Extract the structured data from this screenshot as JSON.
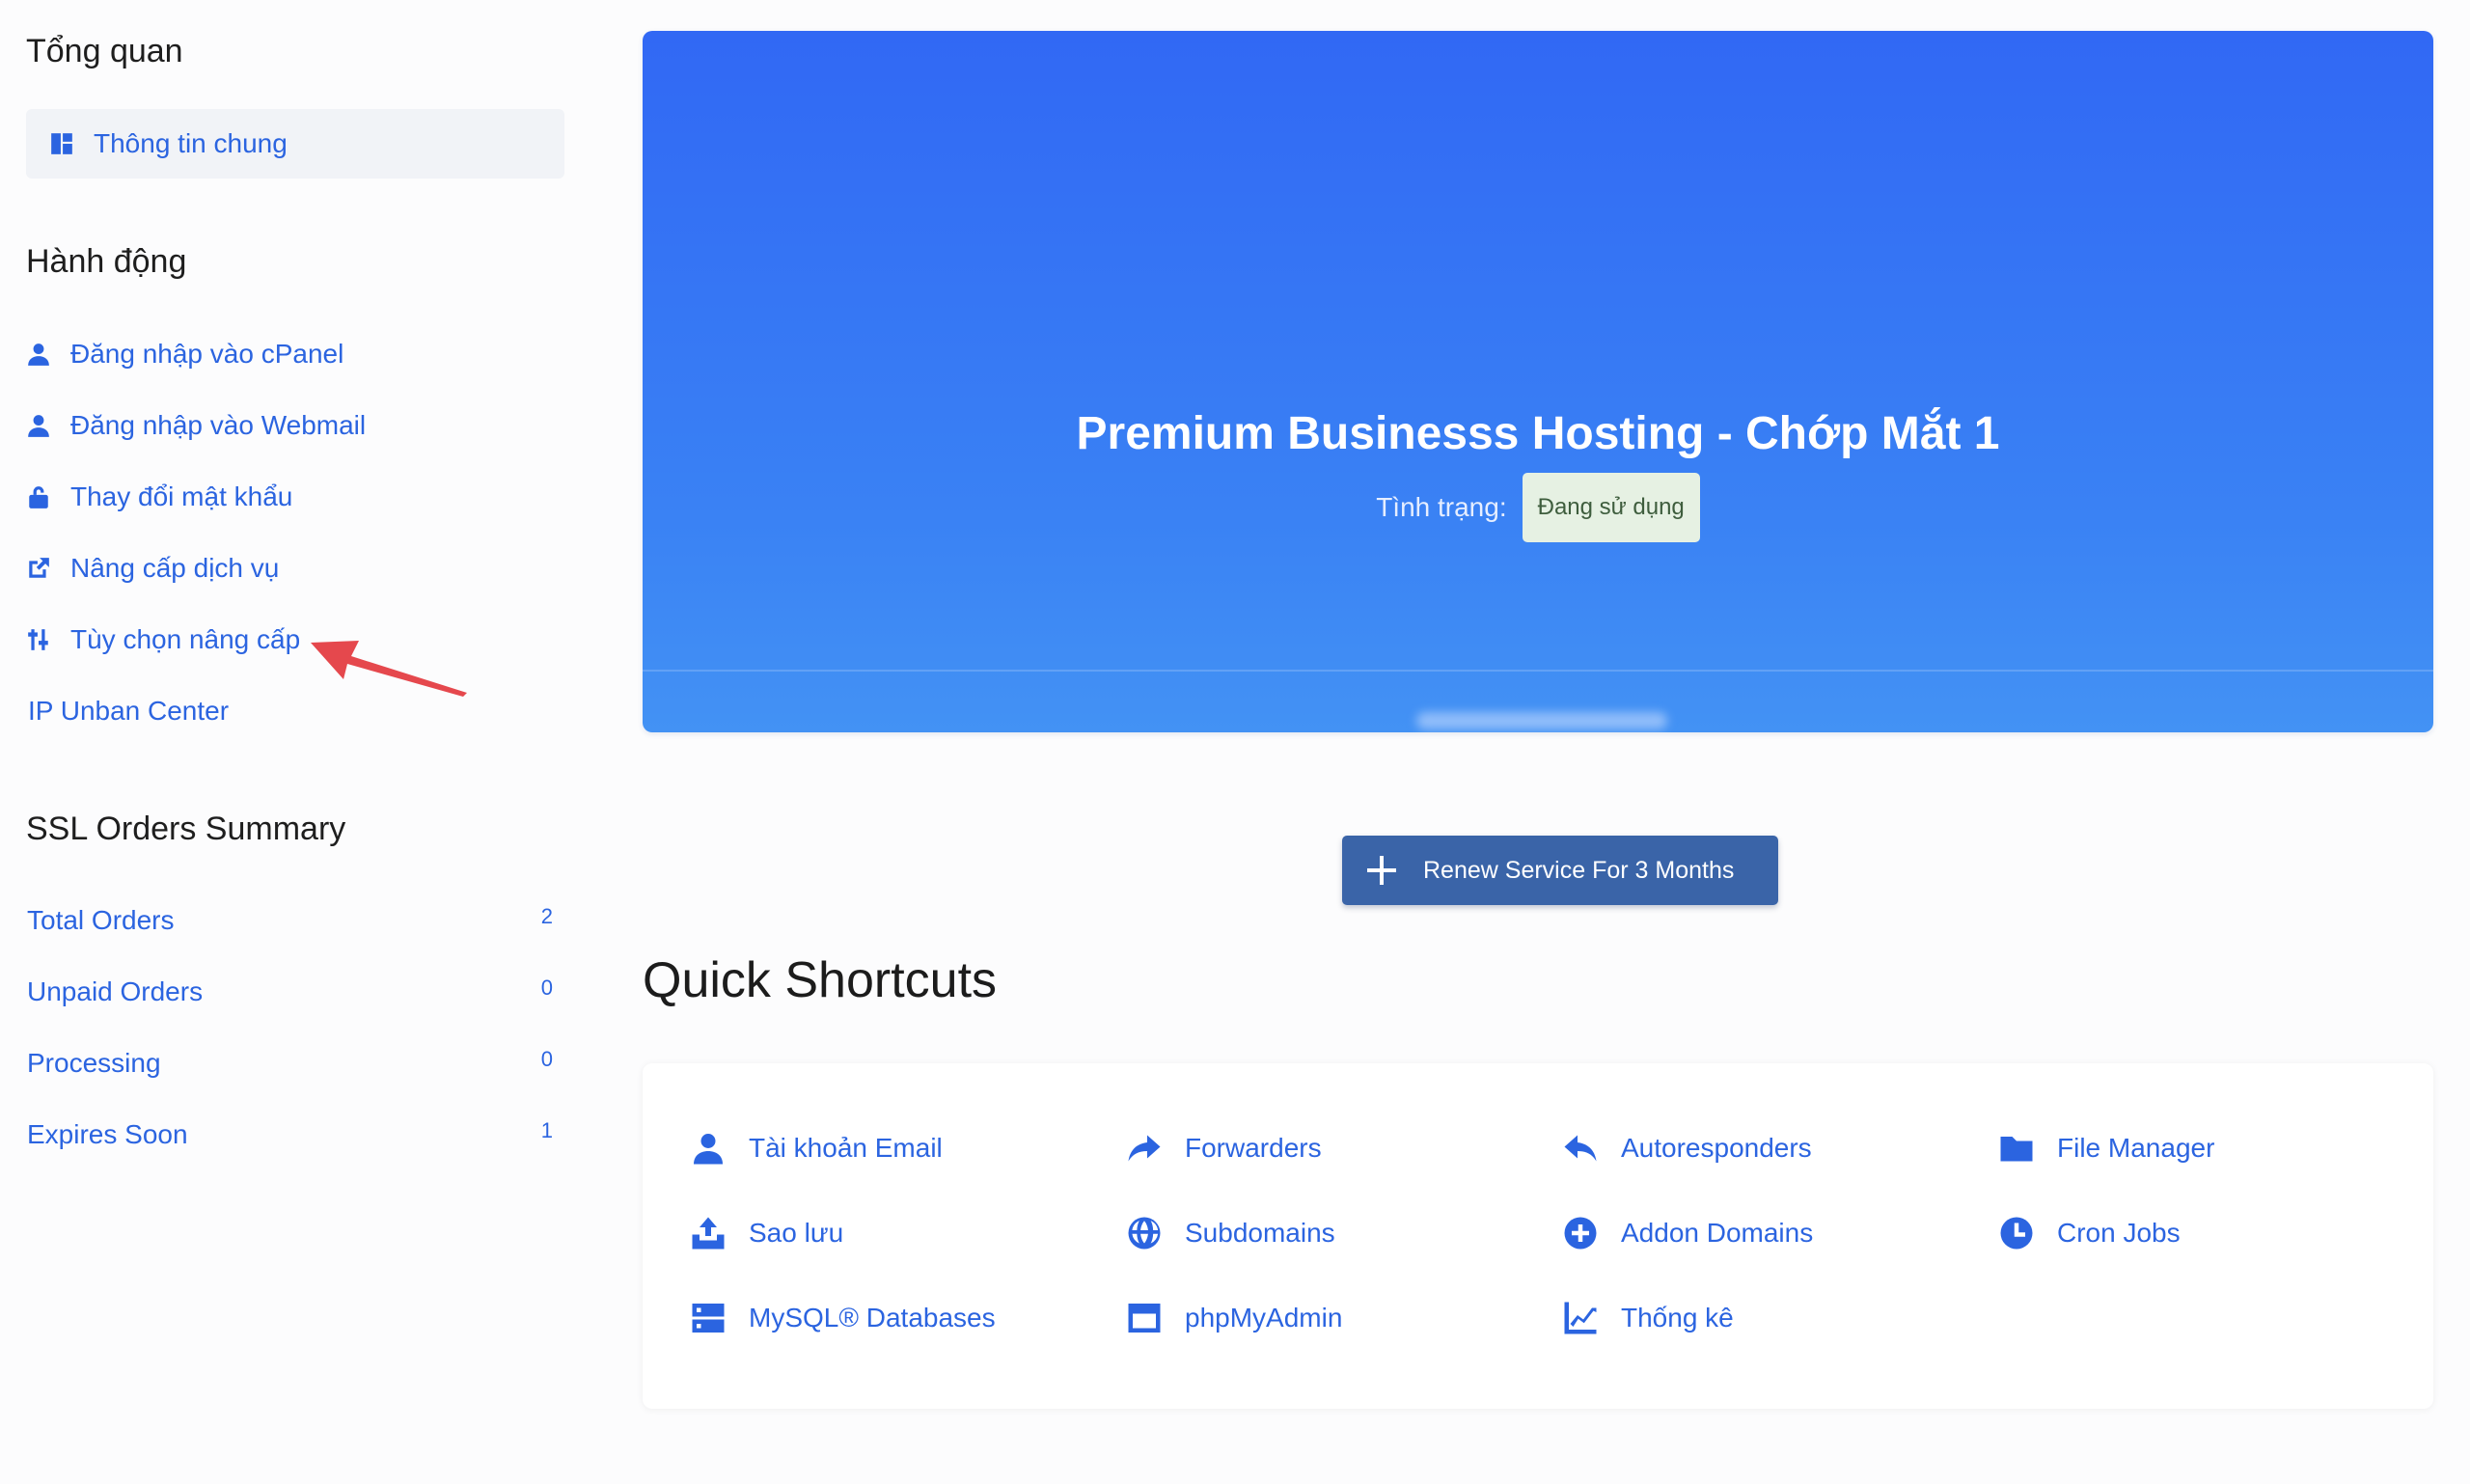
{
  "sidebar": {
    "overview_heading": "Tổng quan",
    "overview_item": "Thông tin chung",
    "actions_heading": "Hành động",
    "actions": [
      {
        "label": "Đăng nhập vào cPanel",
        "icon": "user-icon"
      },
      {
        "label": "Đăng nhập vào Webmail",
        "icon": "user-icon"
      },
      {
        "label": "Thay đổi mật khẩu",
        "icon": "lock-icon"
      },
      {
        "label": "Nâng cấp dịch vụ",
        "icon": "external-link-icon"
      },
      {
        "label": "Tùy chọn nâng cấp",
        "icon": "sliders-icon"
      },
      {
        "label": "IP Unban Center",
        "icon": ""
      }
    ],
    "ssl_heading": "SSL Orders Summary",
    "ssl": [
      {
        "label": "Total Orders",
        "count": "2"
      },
      {
        "label": "Unpaid Orders",
        "count": "0"
      },
      {
        "label": "Processing",
        "count": "0"
      },
      {
        "label": "Expires Soon",
        "count": "1"
      }
    ]
  },
  "hero": {
    "title": "Premium Businesss Hosting - Chớp Mắt 1",
    "status_label": "Tình trạng:",
    "status_value": "Đang sử dụng"
  },
  "renew_button": "Renew Service For 3 Months",
  "quick_shortcuts": {
    "title": "Quick Shortcuts",
    "items": [
      {
        "label": "Tài khoản Email",
        "icon": "user-icon"
      },
      {
        "label": "Forwarders",
        "icon": "share-arrow-icon"
      },
      {
        "label": "Autoresponders",
        "icon": "reply-icon"
      },
      {
        "label": "File Manager",
        "icon": "folder-icon"
      },
      {
        "label": "Sao lưu",
        "icon": "upload-icon"
      },
      {
        "label": "Subdomains",
        "icon": "globe-icon"
      },
      {
        "label": "Addon Domains",
        "icon": "plus-circle-icon"
      },
      {
        "label": "Cron Jobs",
        "icon": "clock-icon"
      },
      {
        "label": "MySQL® Databases",
        "icon": "database-icon"
      },
      {
        "label": "phpMyAdmin",
        "icon": "window-icon"
      },
      {
        "label": "Thống kê",
        "icon": "chart-line-icon"
      }
    ]
  },
  "colors": {
    "link": "#2b64e0",
    "hero_top": "#3168f4",
    "hero_bottom": "#4392f4",
    "button": "#3a64a8",
    "badge_bg": "#e6f1e3",
    "annotation_arrow": "#e5484d"
  }
}
